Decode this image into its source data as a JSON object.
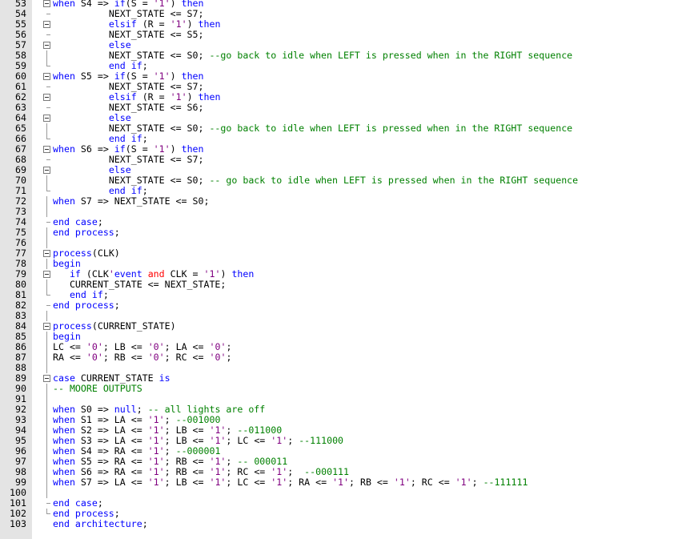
{
  "colors": {
    "keyword": "#0000ff",
    "string": "#800080",
    "comment": "#008000",
    "operator": "#ff0000",
    "text": "#000000",
    "gutter": "#e4e4e4"
  },
  "lines": [
    {
      "n": "53",
      "f": "fold",
      "i": "",
      "t": [
        [
          "kw",
          "when"
        ],
        [
          "txt",
          " S4 => "
        ],
        [
          "kw",
          "if"
        ],
        [
          "txt",
          "(S = "
        ],
        [
          "str",
          "'1'"
        ],
        [
          "txt",
          ") "
        ],
        [
          "kw",
          "then"
        ]
      ]
    },
    {
      "n": "54",
      "f": "tick",
      "i": "          ",
      "t": [
        [
          "txt",
          "NEXT_STATE <= S7;"
        ]
      ]
    },
    {
      "n": "55",
      "f": "fold",
      "i": "          ",
      "t": [
        [
          "kw",
          "elsif"
        ],
        [
          "txt",
          " (R = "
        ],
        [
          "str",
          "'1'"
        ],
        [
          "txt",
          ") "
        ],
        [
          "kw",
          "then"
        ]
      ]
    },
    {
      "n": "56",
      "f": "tick",
      "i": "          ",
      "t": [
        [
          "txt",
          "NEXT_STATE <= S5;"
        ]
      ]
    },
    {
      "n": "57",
      "f": "fold",
      "i": "          ",
      "t": [
        [
          "kw",
          "else"
        ]
      ]
    },
    {
      "n": "58",
      "f": "guide",
      "i": "          ",
      "t": [
        [
          "txt",
          "NEXT_STATE <= S0; "
        ],
        [
          "cm",
          "--go back to idle when LEFT is pressed when in the RIGHT sequence"
        ]
      ]
    },
    {
      "n": "59",
      "f": "end",
      "i": "          ",
      "t": [
        [
          "kw",
          "end if"
        ],
        [
          "txt",
          ";"
        ]
      ]
    },
    {
      "n": "60",
      "f": "fold",
      "i": "",
      "t": [
        [
          "kw",
          "when"
        ],
        [
          "txt",
          " S5 => "
        ],
        [
          "kw",
          "if"
        ],
        [
          "txt",
          "(S = "
        ],
        [
          "str",
          "'1'"
        ],
        [
          "txt",
          ") "
        ],
        [
          "kw",
          "then"
        ]
      ]
    },
    {
      "n": "61",
      "f": "tick",
      "i": "          ",
      "t": [
        [
          "txt",
          "NEXT_STATE <= S7;"
        ]
      ]
    },
    {
      "n": "62",
      "f": "fold",
      "i": "          ",
      "t": [
        [
          "kw",
          "elsif"
        ],
        [
          "txt",
          " (R = "
        ],
        [
          "str",
          "'1'"
        ],
        [
          "txt",
          ") "
        ],
        [
          "kw",
          "then"
        ]
      ]
    },
    {
      "n": "63",
      "f": "tick",
      "i": "          ",
      "t": [
        [
          "txt",
          "NEXT_STATE <= S6;"
        ]
      ]
    },
    {
      "n": "64",
      "f": "fold",
      "i": "          ",
      "t": [
        [
          "kw",
          "else"
        ]
      ]
    },
    {
      "n": "65",
      "f": "guide",
      "i": "          ",
      "t": [
        [
          "txt",
          "NEXT_STATE <= S0; "
        ],
        [
          "cm",
          "--go back to idle when LEFT is pressed when in the RIGHT sequence"
        ]
      ]
    },
    {
      "n": "66",
      "f": "end",
      "i": "          ",
      "t": [
        [
          "kw",
          "end if"
        ],
        [
          "txt",
          ";"
        ]
      ]
    },
    {
      "n": "67",
      "f": "fold",
      "i": "",
      "t": [
        [
          "kw",
          "when"
        ],
        [
          "txt",
          " S6 => "
        ],
        [
          "kw",
          "if"
        ],
        [
          "txt",
          "(S = "
        ],
        [
          "str",
          "'1'"
        ],
        [
          "txt",
          ") "
        ],
        [
          "kw",
          "then"
        ]
      ]
    },
    {
      "n": "68",
      "f": "tick",
      "i": "          ",
      "t": [
        [
          "txt",
          "NEXT_STATE <= S7;"
        ]
      ]
    },
    {
      "n": "69",
      "f": "fold",
      "i": "          ",
      "t": [
        [
          "kw",
          "else"
        ]
      ]
    },
    {
      "n": "70",
      "f": "guide",
      "i": "          ",
      "t": [
        [
          "txt",
          "NEXT_STATE <= S0; "
        ],
        [
          "cm",
          "-- go back to idle when LEFT is pressed when in the RIGHT sequence"
        ]
      ]
    },
    {
      "n": "71",
      "f": "end",
      "i": "          ",
      "t": [
        [
          "kw",
          "end if"
        ],
        [
          "txt",
          ";"
        ]
      ]
    },
    {
      "n": "72",
      "f": "guide",
      "i": "",
      "t": [
        [
          "kw",
          "when"
        ],
        [
          "txt",
          " S7 => NEXT_STATE <= S0;"
        ]
      ]
    },
    {
      "n": "73",
      "f": "guide",
      "i": "",
      "t": []
    },
    {
      "n": "74",
      "f": "tick",
      "i": "",
      "t": [
        [
          "kw",
          "end case"
        ],
        [
          "txt",
          ";"
        ]
      ]
    },
    {
      "n": "75",
      "f": "guide",
      "i": "",
      "t": [
        [
          "kw",
          "end process"
        ],
        [
          "txt",
          ";"
        ]
      ]
    },
    {
      "n": "76",
      "f": "guide",
      "i": "",
      "t": []
    },
    {
      "n": "77",
      "f": "fold",
      "i": "",
      "t": [
        [
          "kw",
          "process"
        ],
        [
          "txt",
          "(CLK)"
        ]
      ]
    },
    {
      "n": "78",
      "f": "guide",
      "i": "",
      "t": [
        [
          "kw",
          "begin"
        ]
      ]
    },
    {
      "n": "79",
      "f": "fold",
      "i": "   ",
      "t": [
        [
          "kw",
          "if"
        ],
        [
          "txt",
          " (CLK"
        ],
        [
          "str",
          "'"
        ],
        [
          "kw",
          "event"
        ],
        [
          "txt",
          " "
        ],
        [
          "op",
          "and"
        ],
        [
          "txt",
          " CLK = "
        ],
        [
          "str",
          "'1'"
        ],
        [
          "txt",
          ") "
        ],
        [
          "kw",
          "then"
        ]
      ]
    },
    {
      "n": "80",
      "f": "guide",
      "i": "   ",
      "t": [
        [
          "txt",
          "CURRENT_STATE <= NEXT_STATE;"
        ]
      ]
    },
    {
      "n": "81",
      "f": "end",
      "i": "   ",
      "t": [
        [
          "kw",
          "end if"
        ],
        [
          "txt",
          ";"
        ]
      ]
    },
    {
      "n": "82",
      "f": "tick",
      "i": "",
      "t": [
        [
          "kw",
          "end process"
        ],
        [
          "txt",
          ";"
        ]
      ]
    },
    {
      "n": "83",
      "f": "guide",
      "i": "",
      "t": []
    },
    {
      "n": "84",
      "f": "fold",
      "i": "",
      "t": [
        [
          "kw",
          "process"
        ],
        [
          "txt",
          "(CURRENT_STATE)"
        ]
      ]
    },
    {
      "n": "85",
      "f": "guide",
      "i": "",
      "t": [
        [
          "kw",
          "begin"
        ]
      ]
    },
    {
      "n": "86",
      "f": "guide",
      "i": "",
      "t": [
        [
          "txt",
          "LC <= "
        ],
        [
          "str",
          "'0'"
        ],
        [
          "txt",
          "; LB <= "
        ],
        [
          "str",
          "'0'"
        ],
        [
          "txt",
          "; LA <= "
        ],
        [
          "str",
          "'0'"
        ],
        [
          "txt",
          ";"
        ]
      ]
    },
    {
      "n": "87",
      "f": "guide",
      "i": "",
      "t": [
        [
          "txt",
          "RA <= "
        ],
        [
          "str",
          "'0'"
        ],
        [
          "txt",
          "; RB <= "
        ],
        [
          "str",
          "'0'"
        ],
        [
          "txt",
          "; RC <= "
        ],
        [
          "str",
          "'0'"
        ],
        [
          "txt",
          ";"
        ]
      ]
    },
    {
      "n": "88",
      "f": "guide",
      "i": "",
      "t": []
    },
    {
      "n": "89",
      "f": "fold",
      "i": "",
      "t": [
        [
          "kw",
          "case"
        ],
        [
          "txt",
          " CURRENT_STATE "
        ],
        [
          "kw",
          "is"
        ]
      ]
    },
    {
      "n": "90",
      "f": "guide",
      "i": "",
      "t": [
        [
          "cm",
          "-- MOORE OUTPUTS"
        ]
      ]
    },
    {
      "n": "91",
      "f": "guide",
      "i": "",
      "t": []
    },
    {
      "n": "92",
      "f": "guide",
      "i": "",
      "t": [
        [
          "kw",
          "when"
        ],
        [
          "txt",
          " S0 => "
        ],
        [
          "kw",
          "null"
        ],
        [
          "txt",
          "; "
        ],
        [
          "cm",
          "-- all lights are off"
        ]
      ]
    },
    {
      "n": "93",
      "f": "guide",
      "i": "",
      "t": [
        [
          "kw",
          "when"
        ],
        [
          "txt",
          " S1 => LA <= "
        ],
        [
          "str",
          "'1'"
        ],
        [
          "txt",
          "; "
        ],
        [
          "cm",
          "--001000"
        ]
      ]
    },
    {
      "n": "94",
      "f": "guide",
      "i": "",
      "t": [
        [
          "kw",
          "when"
        ],
        [
          "txt",
          " S2 => LA <= "
        ],
        [
          "str",
          "'1'"
        ],
        [
          "txt",
          "; LB <= "
        ],
        [
          "str",
          "'1'"
        ],
        [
          "txt",
          "; "
        ],
        [
          "cm",
          "--011000"
        ]
      ]
    },
    {
      "n": "95",
      "f": "guide",
      "i": "",
      "t": [
        [
          "kw",
          "when"
        ],
        [
          "txt",
          " S3 => LA <= "
        ],
        [
          "str",
          "'1'"
        ],
        [
          "txt",
          "; LB <= "
        ],
        [
          "str",
          "'1'"
        ],
        [
          "txt",
          "; LC <= "
        ],
        [
          "str",
          "'1'"
        ],
        [
          "txt",
          "; "
        ],
        [
          "cm",
          "--111000"
        ]
      ]
    },
    {
      "n": "96",
      "f": "guide",
      "i": "",
      "t": [
        [
          "kw",
          "when"
        ],
        [
          "txt",
          " S4 => RA <= "
        ],
        [
          "str",
          "'1'"
        ],
        [
          "txt",
          "; "
        ],
        [
          "cm",
          "--000001"
        ]
      ]
    },
    {
      "n": "97",
      "f": "guide",
      "i": "",
      "t": [
        [
          "kw",
          "when"
        ],
        [
          "txt",
          " S5 => RA <= "
        ],
        [
          "str",
          "'1'"
        ],
        [
          "txt",
          "; RB <= "
        ],
        [
          "str",
          "'1'"
        ],
        [
          "txt",
          "; "
        ],
        [
          "cm",
          "-- 000011"
        ]
      ]
    },
    {
      "n": "98",
      "f": "guide",
      "i": "",
      "t": [
        [
          "kw",
          "when"
        ],
        [
          "txt",
          " S6 => RA <= "
        ],
        [
          "str",
          "'1'"
        ],
        [
          "txt",
          "; RB <= "
        ],
        [
          "str",
          "'1'"
        ],
        [
          "txt",
          "; RC <= "
        ],
        [
          "str",
          "'1'"
        ],
        [
          "txt",
          ";  "
        ],
        [
          "cm",
          "--000111"
        ]
      ]
    },
    {
      "n": "99",
      "f": "guide",
      "i": "",
      "t": [
        [
          "kw",
          "when"
        ],
        [
          "txt",
          " S7 => LA <= "
        ],
        [
          "str",
          "'1'"
        ],
        [
          "txt",
          "; LB <= "
        ],
        [
          "str",
          "'1'"
        ],
        [
          "txt",
          "; LC <= "
        ],
        [
          "str",
          "'1'"
        ],
        [
          "txt",
          "; RA <= "
        ],
        [
          "str",
          "'1'"
        ],
        [
          "txt",
          "; RB <= "
        ],
        [
          "str",
          "'1'"
        ],
        [
          "txt",
          "; RC <= "
        ],
        [
          "str",
          "'1'"
        ],
        [
          "txt",
          "; "
        ],
        [
          "cm",
          "--111111"
        ]
      ]
    },
    {
      "n": "100",
      "f": "guide",
      "i": "",
      "t": []
    },
    {
      "n": "101",
      "f": "tick",
      "i": "",
      "t": [
        [
          "kw",
          "end case"
        ],
        [
          "txt",
          ";"
        ]
      ]
    },
    {
      "n": "102",
      "f": "end",
      "i": "",
      "t": [
        [
          "kw",
          "end process"
        ],
        [
          "txt",
          ";"
        ]
      ]
    },
    {
      "n": "103",
      "f": "",
      "i": "",
      "t": [
        [
          "kw",
          "end architecture"
        ],
        [
          "txt",
          ";"
        ]
      ]
    }
  ]
}
